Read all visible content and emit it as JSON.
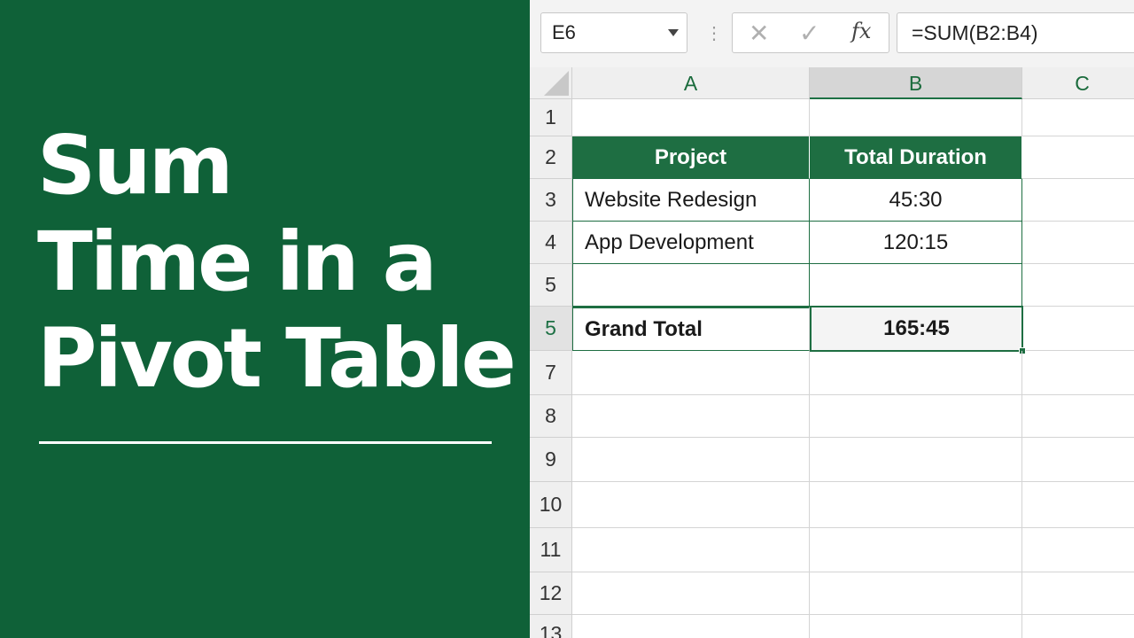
{
  "title": {
    "lines": [
      "Sum",
      "Time in a",
      "Pivot Table"
    ]
  },
  "formula_bar": {
    "name_box": "E6",
    "cancel_icon": "✕",
    "enter_icon": "✓",
    "fx_label": "fx",
    "formula": "=SUM(B2:B4)"
  },
  "columns": [
    "A",
    "B",
    "C"
  ],
  "rows": [
    "1",
    "2",
    "3",
    "4",
    "5",
    "5",
    "7",
    "8",
    "9",
    "10",
    "11",
    "12",
    "13"
  ],
  "table": {
    "headers": [
      "Project",
      "Total Duration"
    ],
    "rows": [
      [
        "Website Redesign",
        "45:30"
      ],
      [
        "App Development",
        "120:15"
      ]
    ],
    "total_label": "Grand Total",
    "total_value": "165:45"
  },
  "colors": {
    "panel_green": "#0f6138",
    "header_green": "#1e6e42"
  }
}
